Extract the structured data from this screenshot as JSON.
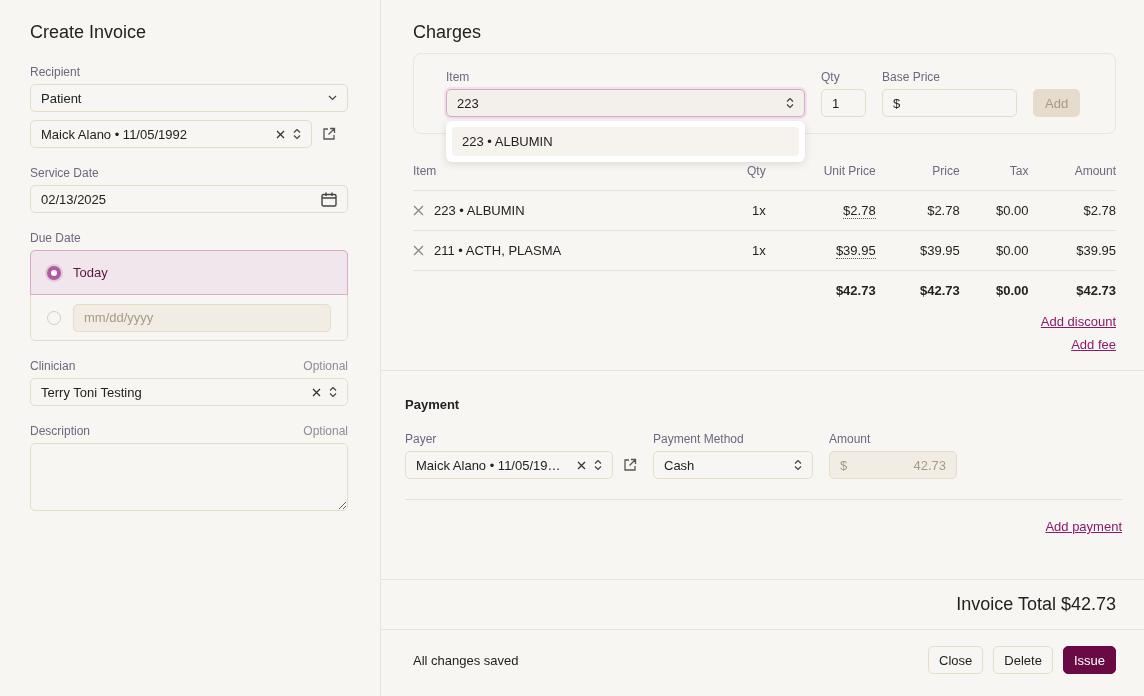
{
  "form": {
    "title": "Create Invoice",
    "recipient": {
      "label": "Recipient",
      "type_value": "Patient",
      "patient_value": "Maick Alano • 11/05/1992"
    },
    "service_date": {
      "label": "Service Date",
      "value": "02/13/2025"
    },
    "due_date": {
      "label": "Due Date",
      "options": [
        {
          "kind": "text",
          "label": "Today",
          "selected": true
        },
        {
          "kind": "date",
          "placeholder": "mm/dd/yyyy",
          "selected": false
        }
      ]
    },
    "clinician": {
      "label": "Clinician",
      "hint": "Optional",
      "value": "Terry Toni Testing"
    },
    "description": {
      "label": "Description",
      "hint": "Optional"
    }
  },
  "charges": {
    "title": "Charges",
    "item_field": {
      "label": "Item",
      "value": "223"
    },
    "qty_field": {
      "label": "Qty",
      "value": "1"
    },
    "price_field": {
      "label": "Base Price",
      "prefix": "$"
    },
    "add_button": {
      "label": "Add",
      "disabled": true
    },
    "suggestions": [
      "223 • ALBUMIN"
    ],
    "table": {
      "columns": [
        "Item",
        "Qty",
        "Unit Price",
        "Price",
        "Tax",
        "Amount"
      ],
      "rows": [
        {
          "item": "223 • ALBUMIN",
          "qty": "1x",
          "unit_price": "$2.78",
          "price": "$2.78",
          "tax": "$0.00",
          "amount": "$2.78"
        },
        {
          "item": "211 • ACTH, PLASMA",
          "qty": "1x",
          "unit_price": "$39.95",
          "price": "$39.95",
          "tax": "$0.00",
          "amount": "$39.95"
        }
      ],
      "totals": {
        "unit_price": "$42.73",
        "price": "$42.73",
        "tax": "$0.00",
        "amount": "$42.73"
      }
    },
    "links": [
      "Add discount",
      "Add fee"
    ]
  },
  "payment": {
    "title": "Payment",
    "payer": {
      "label": "Payer",
      "value": "Maick Alano • 11/05/19…"
    },
    "method": {
      "label": "Payment Method",
      "value": "Cash"
    },
    "amount": {
      "label": "Amount",
      "prefix": "$",
      "value": "42.73",
      "disabled": true
    },
    "link": "Add payment"
  },
  "invoice_total": "Invoice Total $42.73",
  "footer": {
    "status": "All changes saved",
    "buttons": [
      {
        "label": "Close",
        "kind": "secondary"
      },
      {
        "label": "Delete",
        "kind": "secondary"
      },
      {
        "label": "Issue",
        "kind": "primary"
      }
    ]
  }
}
